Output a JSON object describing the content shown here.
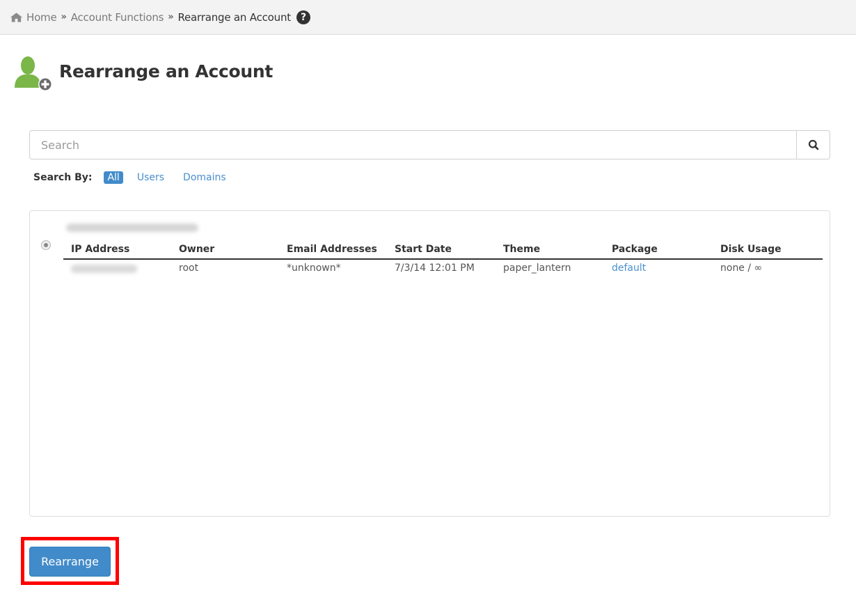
{
  "breadcrumb": {
    "items": [
      {
        "label": "Home",
        "icon": "home-icon"
      },
      {
        "label": "Account Functions"
      },
      {
        "label": "Rearrange an Account"
      }
    ],
    "separator": "»",
    "help_icon": "?"
  },
  "header": {
    "title": "Rearrange an Account",
    "icon": "user-add-icon"
  },
  "search": {
    "placeholder": "Search",
    "value": "",
    "button_icon": "search-icon",
    "search_by_label": "Search By:",
    "options": [
      {
        "label": "All",
        "active": true
      },
      {
        "label": "Users",
        "active": false
      },
      {
        "label": "Domains",
        "active": false
      }
    ]
  },
  "results": {
    "domain": "[redacted]",
    "selected": true,
    "columns": [
      "IP Address",
      "Owner",
      "Email Addresses",
      "Start Date",
      "Theme",
      "Package",
      "Disk Usage"
    ],
    "rows": [
      {
        "ip_address": "[redacted]",
        "owner": "root",
        "email_addresses": "*unknown*",
        "start_date": "7/3/14 12:01 PM",
        "theme": "paper_lantern",
        "package": "default",
        "disk_usage": "none / ∞"
      }
    ]
  },
  "actions": {
    "rearrange_label": "Rearrange"
  },
  "colors": {
    "primary": "#428bca",
    "link": "#4a8fd0",
    "icon_green": "#7ab648",
    "highlight": "#ff0000"
  }
}
